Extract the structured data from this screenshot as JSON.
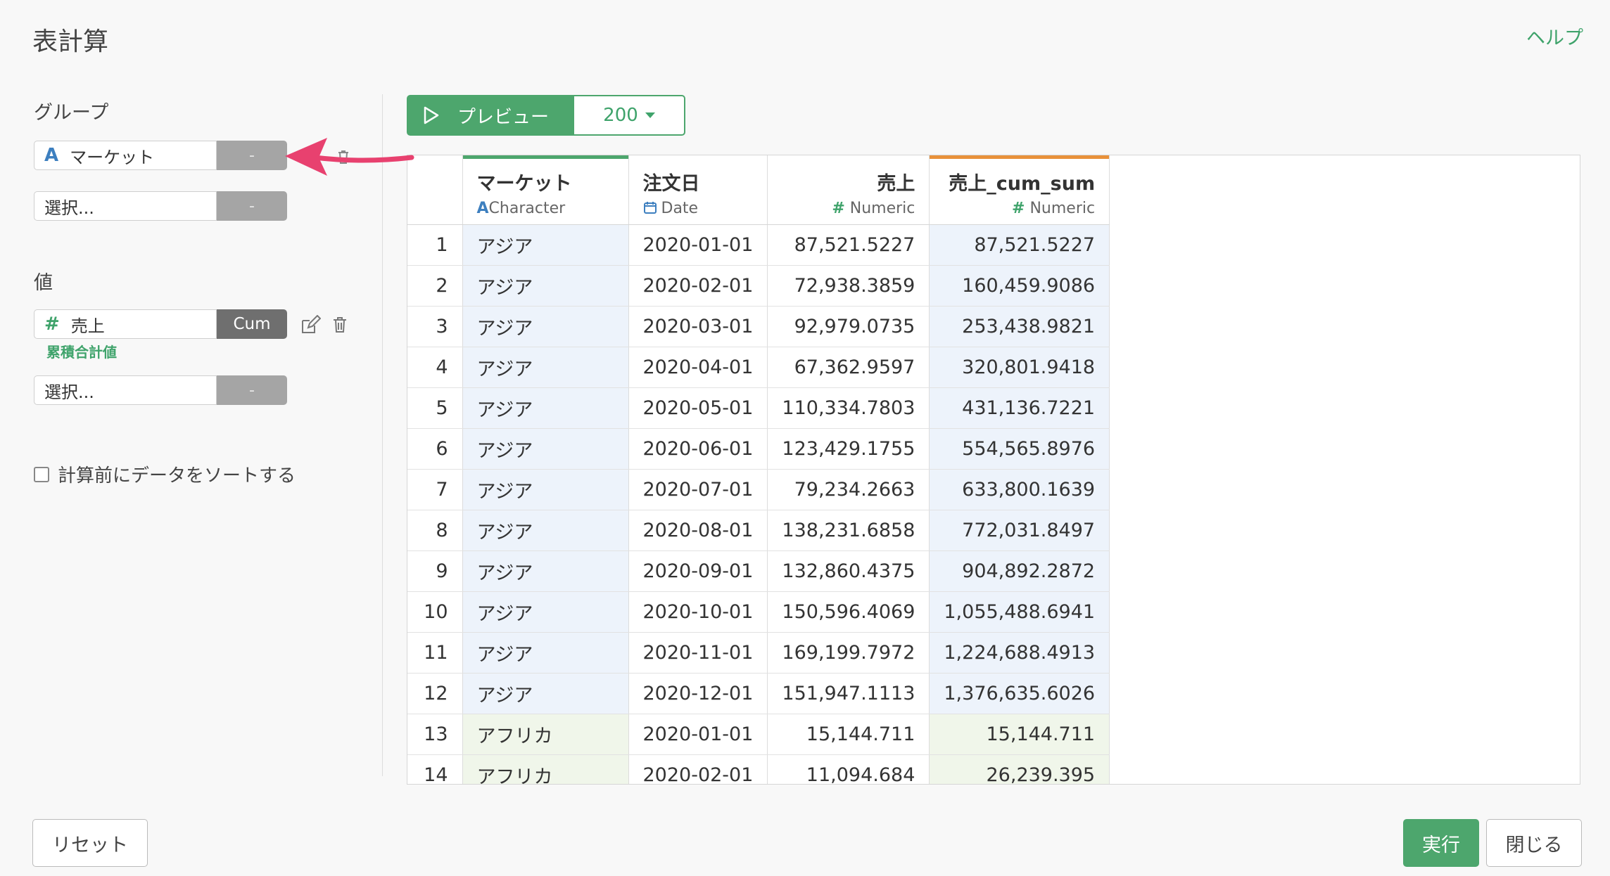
{
  "header": {
    "title": "表計算",
    "help_label": "ヘルプ"
  },
  "group": {
    "label": "グループ",
    "selects": [
      {
        "value": "マーケット",
        "type_icon": "A",
        "button": "-"
      },
      {
        "value": "選択...",
        "button": "-"
      }
    ]
  },
  "values": {
    "label": "値",
    "selects": [
      {
        "value": "売上",
        "type_icon": "#",
        "button": "Cum",
        "sublabel": "累積合計値"
      },
      {
        "value": "選択...",
        "button": "-"
      }
    ]
  },
  "sort_option": {
    "label": "計算前にデータをソートする",
    "checked": false
  },
  "preview": {
    "label": "プレビュー",
    "count": "200"
  },
  "table": {
    "columns": [
      {
        "name": "マーケット",
        "type_icon": "A",
        "type": "Character"
      },
      {
        "name": "注文日",
        "type_icon": "calendar-icon",
        "type": "Date"
      },
      {
        "name": "売上",
        "type_icon": "#",
        "type": "Numeric"
      },
      {
        "name": "売上_cum_sum",
        "type_icon": "#",
        "type": "Numeric"
      }
    ],
    "rows": [
      {
        "idx": "1",
        "market": "アジア",
        "date": "2020-01-01",
        "sales": "87,521.5227",
        "cum": "87,521.5227"
      },
      {
        "idx": "2",
        "market": "アジア",
        "date": "2020-02-01",
        "sales": "72,938.3859",
        "cum": "160,459.9086"
      },
      {
        "idx": "3",
        "market": "アジア",
        "date": "2020-03-01",
        "sales": "92,979.0735",
        "cum": "253,438.9821"
      },
      {
        "idx": "4",
        "market": "アジア",
        "date": "2020-04-01",
        "sales": "67,362.9597",
        "cum": "320,801.9418"
      },
      {
        "idx": "5",
        "market": "アジア",
        "date": "2020-05-01",
        "sales": "110,334.7803",
        "cum": "431,136.7221"
      },
      {
        "idx": "6",
        "market": "アジア",
        "date": "2020-06-01",
        "sales": "123,429.1755",
        "cum": "554,565.8976"
      },
      {
        "idx": "7",
        "market": "アジア",
        "date": "2020-07-01",
        "sales": "79,234.2663",
        "cum": "633,800.1639"
      },
      {
        "idx": "8",
        "market": "アジア",
        "date": "2020-08-01",
        "sales": "138,231.6858",
        "cum": "772,031.8497"
      },
      {
        "idx": "9",
        "market": "アジア",
        "date": "2020-09-01",
        "sales": "132,860.4375",
        "cum": "904,892.2872"
      },
      {
        "idx": "10",
        "market": "アジア",
        "date": "2020-10-01",
        "sales": "150,596.4069",
        "cum": "1,055,488.6941"
      },
      {
        "idx": "11",
        "market": "アジア",
        "date": "2020-11-01",
        "sales": "169,199.7972",
        "cum": "1,224,688.4913"
      },
      {
        "idx": "12",
        "market": "アジア",
        "date": "2020-12-01",
        "sales": "151,947.1113",
        "cum": "1,376,635.6026"
      },
      {
        "idx": "13",
        "market": "アフリカ",
        "date": "2020-01-01",
        "sales": "15,144.711",
        "cum": "15,144.711"
      },
      {
        "idx": "14",
        "market": "アフリカ",
        "date": "2020-02-01",
        "sales": "11,094.684",
        "cum": "26,239.395"
      }
    ]
  },
  "footer": {
    "reset": "リセット",
    "run": "実行",
    "close": "閉じる"
  },
  "colors": {
    "accent": "#4da66d",
    "char_type": "#3d7fbf",
    "cum_col_bar": "#e8913a",
    "annotation_arrow": "#e8416f"
  }
}
